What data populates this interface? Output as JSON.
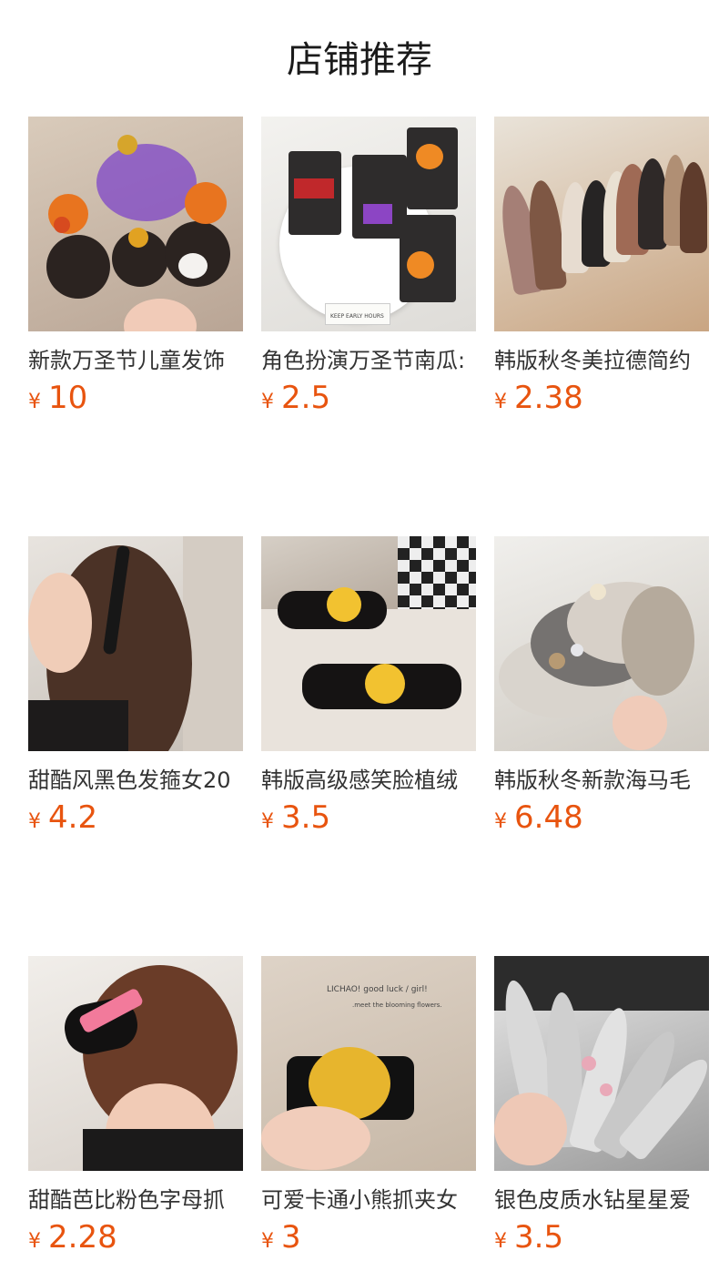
{
  "header": {
    "title": "店铺推荐"
  },
  "products": [
    {
      "name": "新款万圣节儿童发饰",
      "currency": "¥",
      "price": "10",
      "image": "halloween-hair-clips"
    },
    {
      "name": "角色扮演万圣节南瓜:",
      "currency": "¥",
      "price": "2.5",
      "image": "halloween-pumpkin-clips",
      "image_text": [
        "KEEP EARLY HOURS"
      ]
    },
    {
      "name": "韩版秋冬美拉德简约",
      "currency": "¥",
      "price": "2.38",
      "image": "autumn-headbands"
    },
    {
      "name": "甜酷风黑色发箍女20",
      "currency": "¥",
      "price": "4.2",
      "image": "black-headband-model"
    },
    {
      "name": "韩版高级感笑脸植绒",
      "currency": "¥",
      "price": "3.5",
      "image": "smiley-claw-clips"
    },
    {
      "name": "韩版秋冬新款海马毛",
      "currency": "¥",
      "price": "6.48",
      "image": "fuzzy-button-headbands"
    },
    {
      "name": "甜酷芭比粉色字母抓",
      "currency": "¥",
      "price": "2.28",
      "image": "barbie-claw-clip-model"
    },
    {
      "name": "可爱卡通小熊抓夹女",
      "currency": "¥",
      "price": "3",
      "image": "bear-claw-clip",
      "image_text": [
        "LICHAO! good luck / girl!",
        ".meet the blooming flowers."
      ]
    },
    {
      "name": "银色皮质水钻星星爱",
      "currency": "¥",
      "price": "3.5",
      "image": "silver-rhinestone-headbands"
    }
  ]
}
